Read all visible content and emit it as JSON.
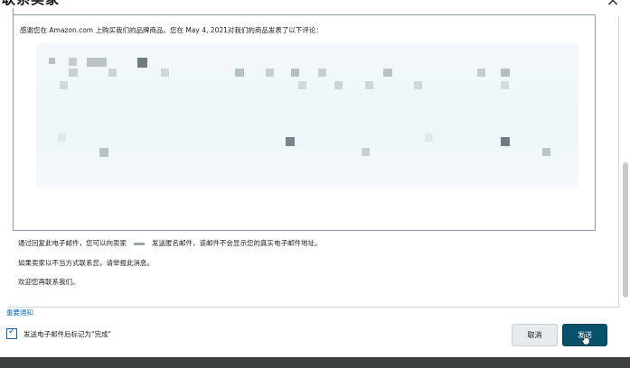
{
  "dialog": {
    "title": "联系卖家"
  },
  "message": {
    "intro": "感谢您在 Amazon.com 上购买我们的品牌商品。您在 May 4, 2021对我们的商品发表了以下评论："
  },
  "info": {
    "line1_before": "通过回复此电子邮件，您可以向卖家",
    "line1_after": "发送匿名邮件，该邮件不会显示您的真实电子邮件地址。",
    "line2": "如果卖家以不当方式联系您，请举报此消息。",
    "line3": "欢迎您再联系我们。"
  },
  "links": {
    "important_notice": "重要通知"
  },
  "checkbox": {
    "label": "发送电子邮件后标记为\"完成\"",
    "checked": true
  },
  "buttons": {
    "cancel": "取消",
    "send": "发送"
  },
  "colors": {
    "primary": "#08516b",
    "link": "#0a6ec7",
    "footer": "#3c3f40"
  }
}
